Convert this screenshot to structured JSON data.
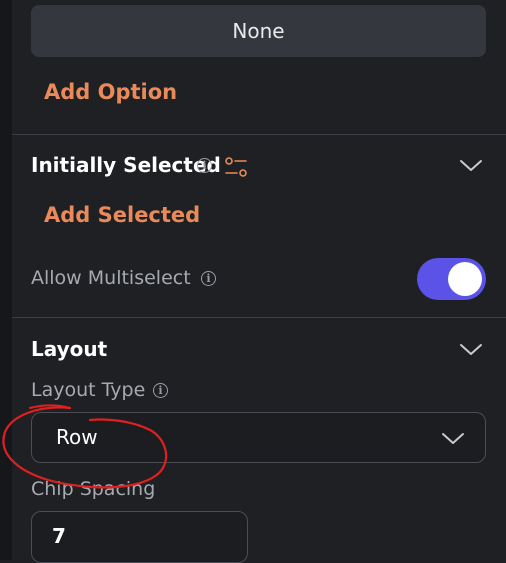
{
  "options": {
    "none_label": "None",
    "add_option_label": "Add Option"
  },
  "initially_selected": {
    "title": "Initially Selected",
    "add_selected_label": "Add Selected"
  },
  "allow_multiselect": {
    "label": "Allow Multiselect",
    "enabled": true
  },
  "layout": {
    "title": "Layout",
    "layout_type_label": "Layout Type",
    "layout_type_value": "Row",
    "chip_spacing_label": "Chip Spacing",
    "chip_spacing_value": "7"
  },
  "colors": {
    "background": "#1e2023",
    "accent_link": "#ea8a5a",
    "toggle_on": "#5b52e7",
    "annotation": "#e02020"
  }
}
